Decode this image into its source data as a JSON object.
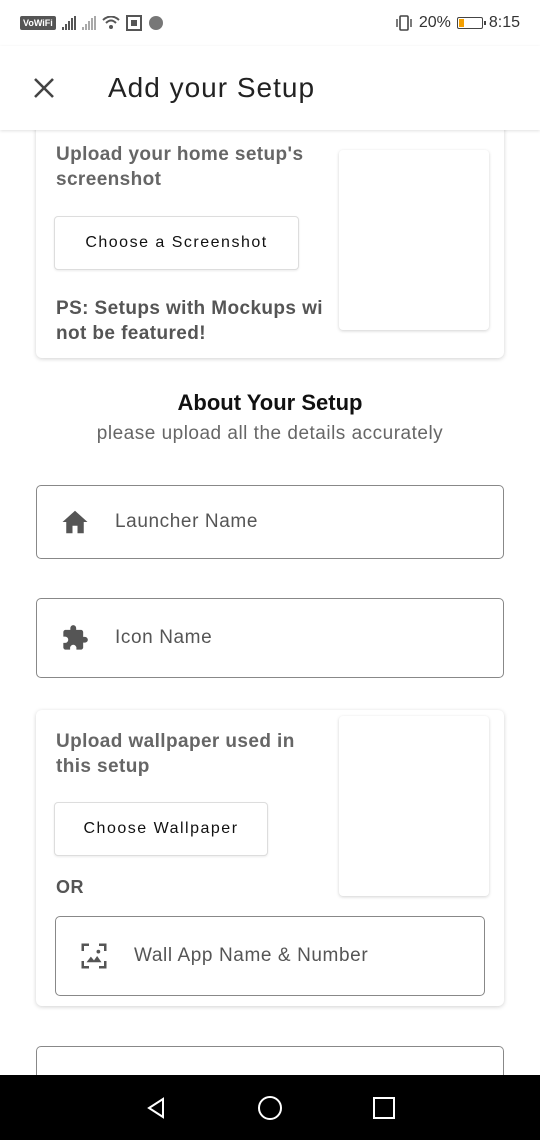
{
  "status_bar": {
    "vowifi": "VoWiFi",
    "battery_percent": "20%",
    "time": "8:15",
    "battery_level": 0.2,
    "battery_color": "#f5a000"
  },
  "appbar": {
    "title": "Add your Setup",
    "close_icon": "close-icon"
  },
  "screenshot_card": {
    "label": "Upload your home setup's screenshot",
    "button": "Choose a Screenshot",
    "note": "PS: Setups with Mockups will not be featured!",
    "note_line1": "PS: Setups with Mockups wi",
    "note_line2": "not be featured!"
  },
  "about": {
    "title": "About Your Setup",
    "subtitle": "please upload all the details accurately"
  },
  "fields": {
    "launcher_placeholder": "Launcher Name",
    "launcher_icon": "home-icon",
    "icon_placeholder": "Icon Name",
    "icon_icon": "puzzle-icon"
  },
  "wallpaper_card": {
    "label": "Upload wallpaper used in this setup",
    "button": "Choose Wallpaper",
    "or_label": "OR",
    "wall_app_placeholder": "Wall App Name & Number",
    "wall_app_icon": "wallpaper-icon"
  },
  "navbar": {
    "back_icon": "back-triangle-icon",
    "home_icon": "home-circle-icon",
    "recents_icon": "recents-square-icon"
  }
}
